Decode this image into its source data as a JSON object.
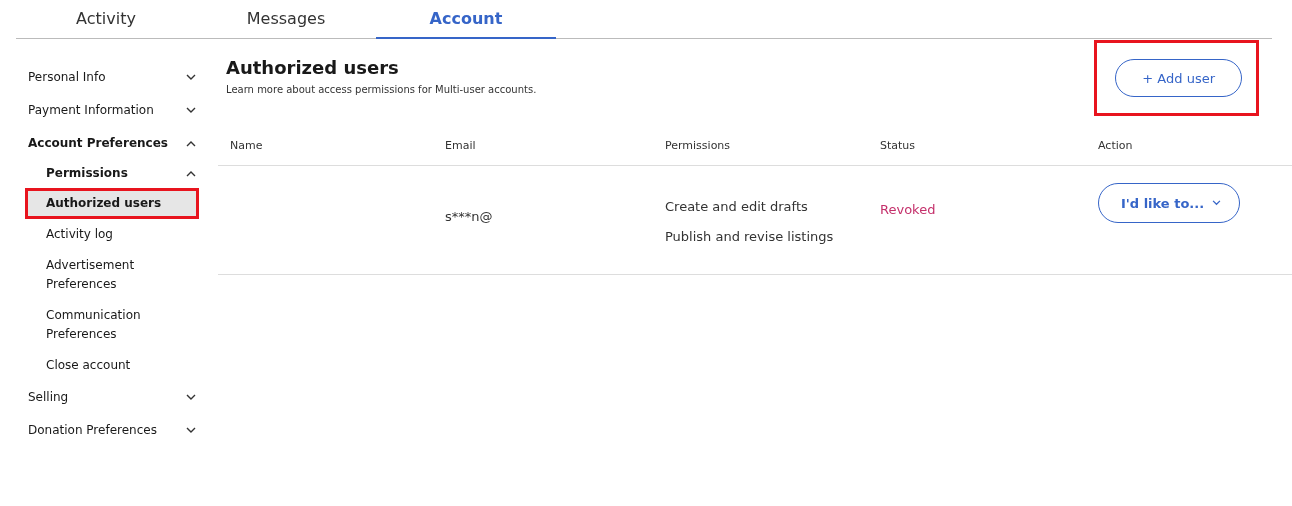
{
  "tabs": [
    {
      "label": "Activity",
      "selected": false
    },
    {
      "label": "Messages",
      "selected": false
    },
    {
      "label": "Account",
      "selected": true
    }
  ],
  "sidebar": {
    "items": [
      {
        "label": "Personal Info",
        "expanded": false
      },
      {
        "label": "Payment Information",
        "expanded": false
      },
      {
        "label": "Account Preferences",
        "expanded": true,
        "children": [
          {
            "label": "Permissions",
            "expanded": true,
            "children": [
              {
                "label": "Authorized users",
                "selected": true,
                "highlighted": true
              },
              {
                "label": "Activity log",
                "selected": false,
                "highlighted": false
              }
            ]
          },
          {
            "label": "Advertisement Preferences",
            "selected": false,
            "highlighted": false
          },
          {
            "label": "Communication Preferences",
            "selected": false,
            "highlighted": false
          },
          {
            "label": "Close account",
            "selected": false,
            "highlighted": false
          }
        ]
      },
      {
        "label": "Selling",
        "expanded": false
      },
      {
        "label": "Donation Preferences",
        "expanded": false
      }
    ]
  },
  "main": {
    "title": "Authorized users",
    "subtitle": "Learn more about access permissions for Multi-user accounts.",
    "add_button": {
      "label": "+ Add user",
      "highlighted": true
    },
    "table": {
      "columns": [
        "Name",
        "Email",
        "Permissions",
        "Status",
        "Action"
      ],
      "rows": [
        {
          "email": "s***n@",
          "permissions": [
            "Create and edit drafts",
            "Publish and revise listings"
          ],
          "status": "Revoked",
          "action": "I'd like to..."
        }
      ]
    }
  }
}
